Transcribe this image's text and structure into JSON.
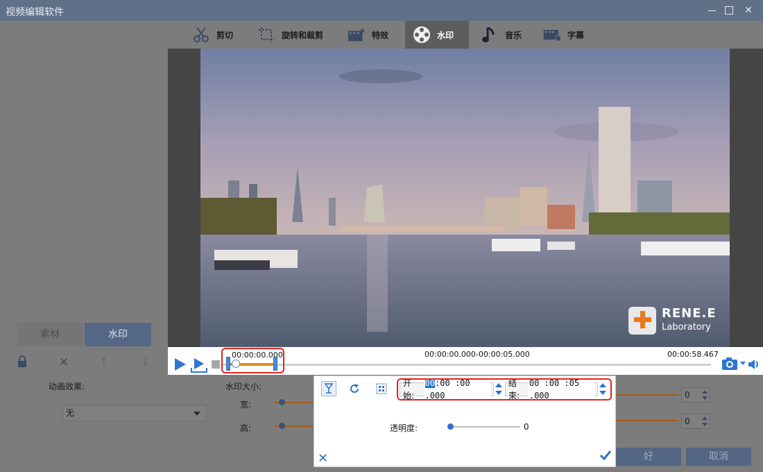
{
  "window": {
    "title": "视频编辑软件"
  },
  "tabs": [
    {
      "label": "剪切",
      "icon": "scissors-icon"
    },
    {
      "label": "旋转和裁剪",
      "icon": "crop-rotate-icon"
    },
    {
      "label": "特效",
      "icon": "film-effects-icon"
    },
    {
      "label": "水印",
      "icon": "film-reel-icon",
      "active": true
    },
    {
      "label": "音乐",
      "icon": "music-note-icon"
    },
    {
      "label": "字幕",
      "icon": "subtitles-icon"
    }
  ],
  "left_panel": {
    "tab_material": "素材",
    "tab_watermark": "水印",
    "animation_label": "动画效果:",
    "animation_value": "无",
    "watermark_size_label": "水印大小:",
    "width_label": "宽:",
    "height_label": "高:",
    "width_value": "0",
    "height_value": "0"
  },
  "buttons": {
    "ok": "好",
    "cancel": "取消"
  },
  "player": {
    "current_time": "00:00:00.000",
    "range": "00:00:00.000-00:00:05.000",
    "duration": "00:00:58.467"
  },
  "watermark_logo": {
    "name": "RENE.E",
    "sub": "Laboratory"
  },
  "popup": {
    "start_label": "开始:",
    "start_hh": "00",
    "start_rest": ":00 :00 .000",
    "end_label": "结束:",
    "end_value": "00 :00 :05 .000",
    "opacity_label": "透明度:",
    "opacity_value": "0"
  },
  "colors": {
    "accent_orange": "#e98a1c",
    "accent_blue": "#4a8ad6",
    "highlight_red": "#e0231f",
    "titlebar": "#5f7088"
  }
}
